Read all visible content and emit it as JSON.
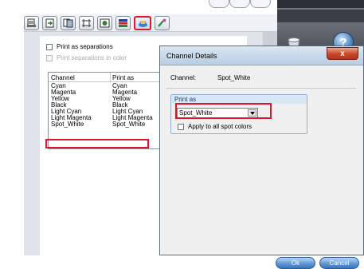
{
  "toolbar": {
    "buttons": [
      {
        "name": "page-setup-tab",
        "icon": "printer-page-icon"
      },
      {
        "name": "layout-tab",
        "icon": "arrow-page-icon"
      },
      {
        "name": "pages-tab",
        "icon": "pages-icon"
      },
      {
        "name": "marks-tab",
        "icon": "marks-icon"
      },
      {
        "name": "prepress-tab",
        "icon": "prepress-icon"
      },
      {
        "name": "color-tab",
        "icon": "color-management-icon"
      },
      {
        "name": "separations-tab",
        "icon": "separations-icon",
        "active": true
      },
      {
        "name": "paint-tab",
        "icon": "brush-icon"
      }
    ]
  },
  "separations": {
    "print_as_separations": "Print as separations",
    "print_separations_in_color": "Print separations in color",
    "table": {
      "headers": [
        "Channel",
        "Print as"
      ],
      "rows": [
        {
          "channel": "Cyan",
          "print_as": "Cyan"
        },
        {
          "channel": "Magenta",
          "print_as": "Magenta"
        },
        {
          "channel": "Yellow",
          "print_as": "Yellow"
        },
        {
          "channel": "Black",
          "print_as": "Black"
        },
        {
          "channel": "Light Cyan",
          "print_as": "Light Cyan"
        },
        {
          "channel": "Light Magenta",
          "print_as": "Light Magenta"
        },
        {
          "channel": "Spot_White",
          "print_as": "Spot_White",
          "highlighted": true
        }
      ]
    }
  },
  "dialog": {
    "title": "Channel Details",
    "close_label": "x",
    "channel_label": "Channel:",
    "channel_value": "Spot_White",
    "print_as_group": "Print as",
    "print_as_selected": "Spot_White",
    "apply_all_label": "Apply to all spot colors",
    "ok_label": "Ok",
    "cancel_label": "Cancel"
  },
  "right_panel": {
    "help_label": "?"
  },
  "colors": {
    "highlight": "#e0152c",
    "panel_bg": "#dfe4ea",
    "dark_bg": "#3b3f45",
    "button_blue": "#5c94d3"
  }
}
